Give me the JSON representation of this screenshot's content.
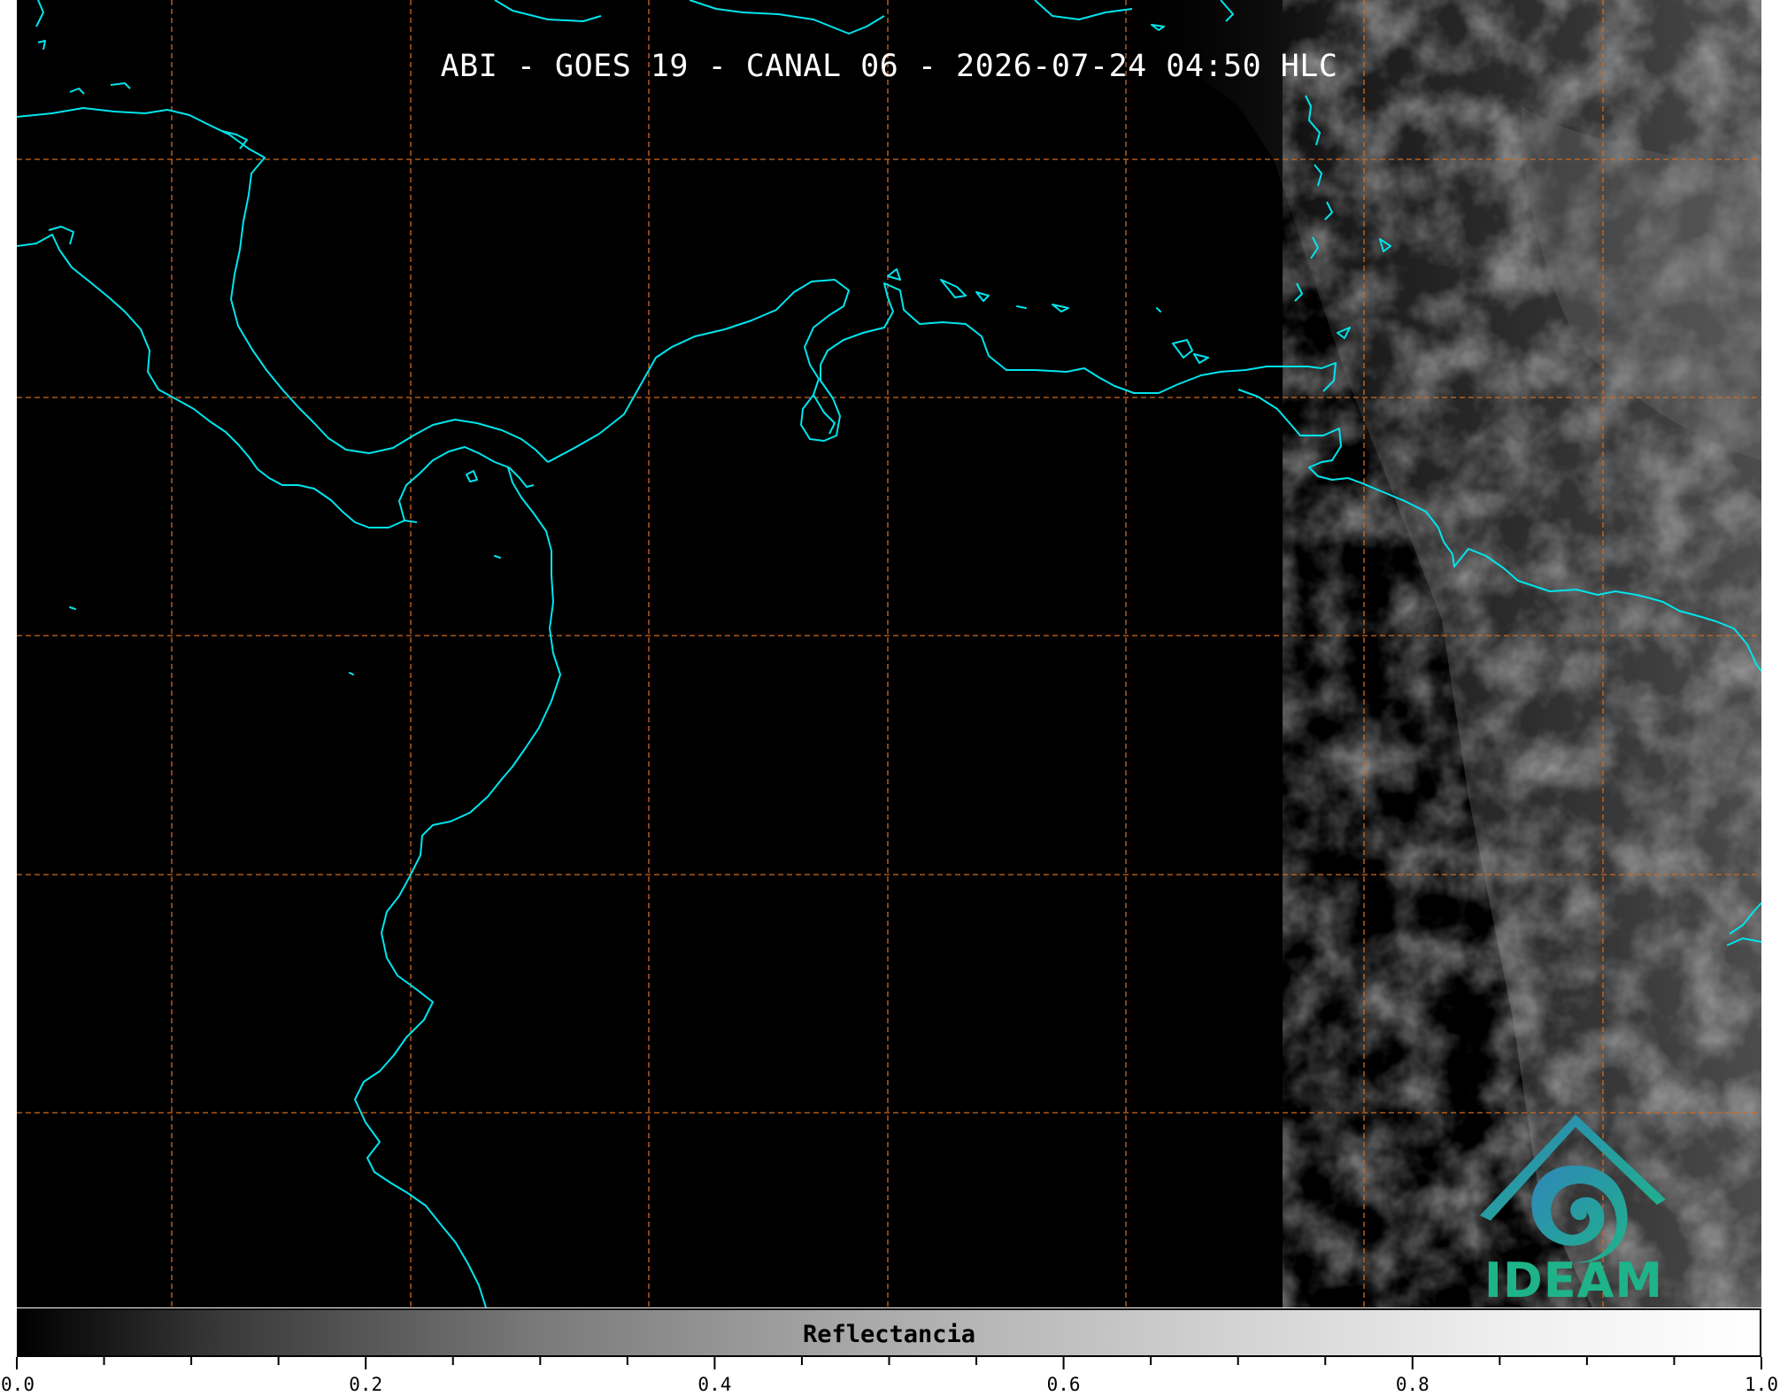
{
  "title": "ABI - GOES 19 - CANAL 06 - 2026-07-24 04:50 HLC",
  "logo": {
    "text": "IDEAM",
    "icon": "ideam-logo-icon",
    "colors": {
      "blue": "#2f86b8",
      "teal": "#1fb38a"
    }
  },
  "colorbar": {
    "label": "Reflectancia",
    "min": 0.0,
    "max": 1.0,
    "tick_labels": [
      "0.0",
      "0.2",
      "0.4",
      "0.6",
      "0.8",
      "1.0"
    ]
  },
  "colors": {
    "background": "#000000",
    "coastline": "#00e5ee",
    "gridlines": "#d2691e",
    "clouds": "#5a5a5a"
  }
}
